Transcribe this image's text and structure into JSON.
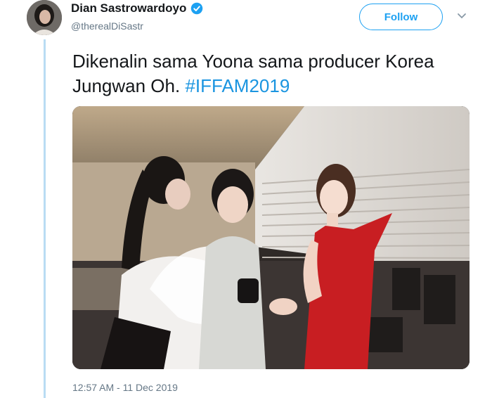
{
  "tweet": {
    "author_name": "Dian Sastrowardoyo",
    "handle": "@therealDiSastr",
    "follow_label": "Follow",
    "text_main": "Dikenalin sama Yoona sama producer Korea Jungwan Oh. ",
    "hashtag": "#IFFAM2019",
    "timestamp": "12:57 AM - 11 Dec 2019"
  },
  "icons": {
    "verified": "verified-badge-icon",
    "chevron": "chevron-down-icon"
  },
  "colors": {
    "accent": "#1da1f2",
    "hashtag": "#1b95e0",
    "thread_line": "#b9dcf3",
    "muted_text": "#657786"
  }
}
